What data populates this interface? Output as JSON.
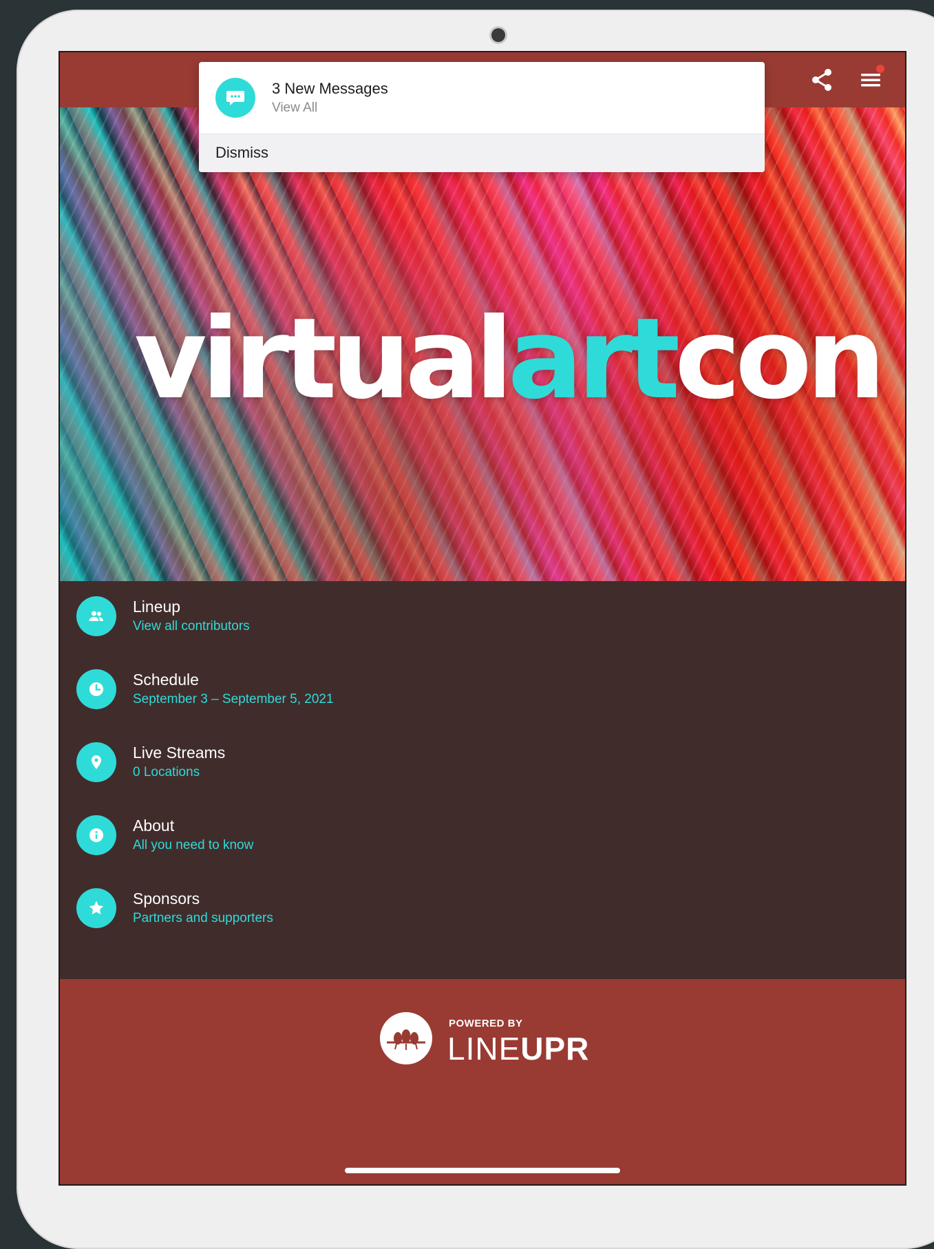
{
  "topbar": {
    "share_icon": "share-icon",
    "menu_icon": "hamburger-menu-icon",
    "badge_color": "#e8453c"
  },
  "notification": {
    "title": "3 New Messages",
    "subtitle": "View All",
    "dismiss_label": "Dismiss",
    "icon": "chat-bubble-icon"
  },
  "hero": {
    "logo_part1": "virtual",
    "logo_part2": "art",
    "logo_part3": "con"
  },
  "menu": {
    "items": [
      {
        "title": "Lineup",
        "subtitle": "View all contributors",
        "icon": "people-icon"
      },
      {
        "title": "Schedule",
        "subtitle": "September 3 – September 5, 2021",
        "icon": "clock-icon"
      },
      {
        "title": "Live Streams",
        "subtitle": "0 Locations",
        "icon": "location-pin-icon"
      },
      {
        "title": "About",
        "subtitle": "All you need to know",
        "icon": "info-icon"
      },
      {
        "title": "Sponsors",
        "subtitle": "Partners and supporters",
        "icon": "star-icon"
      }
    ]
  },
  "footer": {
    "powered_by": "POWERED BY",
    "brand_light": "LINE",
    "brand_bold": "UPR"
  },
  "colors": {
    "accent": "#2fdbd8",
    "primary": "#993b33",
    "menu_bg": "#412c2c"
  }
}
